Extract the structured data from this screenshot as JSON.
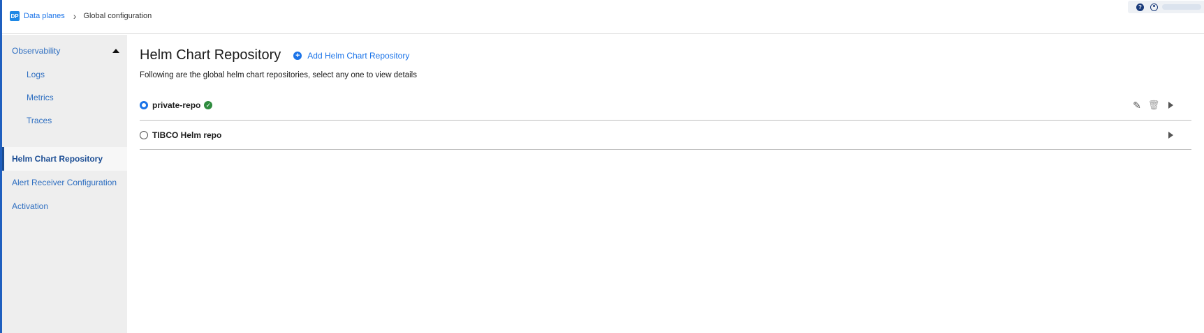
{
  "breadcrumb": {
    "logo": "DP",
    "root": "Data planes",
    "separator": "›",
    "current": "Global configuration"
  },
  "header": {
    "help_icon": "?"
  },
  "sidebar": {
    "items": [
      {
        "label": "Observability",
        "expanded": true
      },
      {
        "label": "Logs"
      },
      {
        "label": "Metrics"
      },
      {
        "label": "Traces"
      },
      {
        "label": "Helm Chart Repository",
        "active": true
      },
      {
        "label": "Alert Receiver Configuration"
      },
      {
        "label": "Activation"
      }
    ]
  },
  "main": {
    "title": "Helm Chart Repository",
    "add_label": "Add Helm Chart Repository",
    "add_icon": "+",
    "subtitle": "Following are the global helm chart repositories, select any one to view details",
    "repos": [
      {
        "name": "private-repo",
        "selected": true,
        "status_icon": "✓",
        "editable": true
      },
      {
        "name": "TIBCO Helm repo",
        "selected": false,
        "editable": false
      }
    ]
  },
  "colors": {
    "accent": "#1a73e8",
    "sidebar_bg": "#eeeeee",
    "active_text": "#1b4d94",
    "success": "#2e8b3e"
  }
}
